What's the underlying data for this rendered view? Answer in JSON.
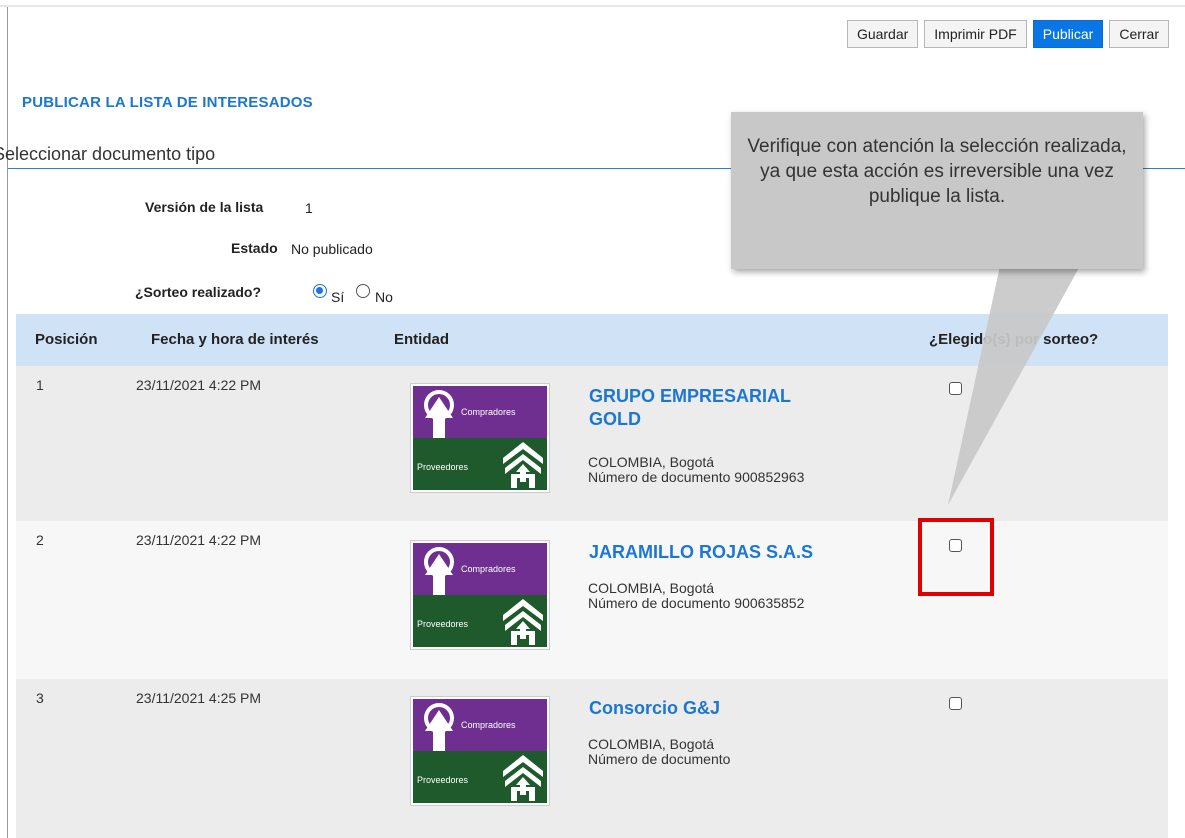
{
  "toolbar": {
    "guardar": "Guardar",
    "imprimir": "Imprimir PDF",
    "publicar": "Publicar",
    "cerrar": "Cerrar"
  },
  "page": {
    "title": "PUBLICAR LA LISTA DE INTERESADOS",
    "subtitle": "Seleccionar documento tipo"
  },
  "fields": {
    "version_label": "Versión de la lista",
    "version_value": "1",
    "estado_label": "Estado",
    "estado_value": "No publicado",
    "sorteo_label": "¿Sorteo realizado?",
    "si": "Sí",
    "no": "No",
    "sorteo_selected": "Sí"
  },
  "table": {
    "headers": [
      "Posición",
      "Fecha y hora de interés",
      "Entidad",
      "¿Elegido(s) por sorteo?"
    ],
    "rows": [
      {
        "pos": "1",
        "fecha": "23/11/2021 4:22 PM",
        "name_l1": "GRUPO EMPRESARIAL",
        "name_l2": "GOLD",
        "location": "COLOMBIA, Bogotá",
        "doc": "Número de documento 900852963",
        "checked": false
      },
      {
        "pos": "2",
        "fecha": "23/11/2021 4:22 PM",
        "name_l1": "JARAMILLO ROJAS S.A.S",
        "name_l2": "",
        "location": "COLOMBIA, Bogotá",
        "doc": "Número de documento 900635852",
        "checked": false
      },
      {
        "pos": "3",
        "fecha": "23/11/2021 4:25 PM",
        "name_l1": "Consorcio G&J",
        "name_l2": "",
        "location": "COLOMBIA, Bogotá",
        "doc": "Número de documento",
        "checked": false
      }
    ]
  },
  "logo": {
    "top": "Compradores",
    "bottom": "Proveedores"
  },
  "callout": {
    "text": "Verifique con atención la selección realizada, ya que esta acción es irreversible una vez publique la lista."
  },
  "colors": {
    "primary": "#0a76e6",
    "link": "#1b77d2",
    "header_bg": "#cfe2f6",
    "logo_purple": "#6f2f91",
    "logo_green": "#1f5a2c",
    "highlight": "#e10000"
  }
}
